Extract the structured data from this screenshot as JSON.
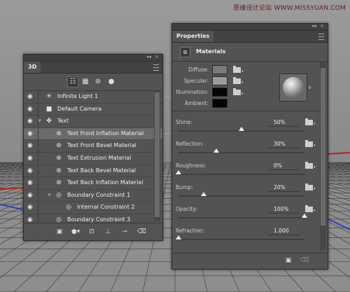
{
  "watermark": "思缘设计论坛 WWW.MISSYUAN.COM",
  "panel3d": {
    "tab_label": "3D",
    "filter_icons": [
      "scene-filter-icon",
      "mesh-filter-icon",
      "material-filter-icon",
      "light-filter-icon"
    ],
    "layers": [
      {
        "label": "Infinite Light 1",
        "icon": "✳",
        "icon_name": "infinite-light-icon",
        "indent": 0,
        "twisty": "",
        "selected": false
      },
      {
        "label": "Default Camera",
        "icon": "■",
        "icon_name": "camera-icon",
        "indent": 0,
        "twisty": "",
        "selected": false
      },
      {
        "label": "Text",
        "icon": "✤",
        "icon_name": "mesh-icon",
        "indent": 0,
        "twisty": "∨",
        "selected": false
      },
      {
        "label": "Text Front Inflation Material",
        "icon": "⊛",
        "icon_name": "material-icon",
        "indent": 1,
        "twisty": "",
        "selected": true
      },
      {
        "label": "Text Front Bevel Material",
        "icon": "⊛",
        "icon_name": "material-icon",
        "indent": 1,
        "twisty": "",
        "selected": false
      },
      {
        "label": "Text Extrusion Material",
        "icon": "⊛",
        "icon_name": "material-icon",
        "indent": 1,
        "twisty": "",
        "selected": false
      },
      {
        "label": "Text Back Bevel Material",
        "icon": "⊛",
        "icon_name": "material-icon",
        "indent": 1,
        "twisty": "",
        "selected": false
      },
      {
        "label": "Text Back Inflation Material",
        "icon": "⊛",
        "icon_name": "material-icon",
        "indent": 1,
        "twisty": "",
        "selected": false
      },
      {
        "label": "Boundary Constraint 1",
        "icon": "◎",
        "icon_name": "constraint-icon",
        "indent": 1,
        "twisty": "∨",
        "selected": false
      },
      {
        "label": "Internal Constraint 2",
        "icon": "◎",
        "icon_name": "constraint-icon",
        "indent": 2,
        "twisty": "",
        "selected": false
      },
      {
        "label": "Boundary Constraint 3",
        "icon": "◎",
        "icon_name": "constraint-icon",
        "indent": 1,
        "twisty": "",
        "selected": false
      }
    ],
    "bottom_icons": [
      "render-icon",
      "add-light-icon",
      "add-material-icon",
      "ground-icon",
      "constraint-add-icon",
      "trash-icon"
    ]
  },
  "properties": {
    "tab_label": "Properties",
    "section_title": "Materials",
    "material_rows": [
      {
        "label": "Diffuse:",
        "color": "#7a7a7a",
        "folder": true
      },
      {
        "label": "Specular:",
        "color": "#9a9a9a",
        "folder": true
      },
      {
        "label": "Illumination:",
        "color": "#050505",
        "folder": true
      },
      {
        "label": "Ambient:",
        "color": "#050505",
        "folder": false
      }
    ],
    "sliders": [
      {
        "label": "Shine:",
        "value": "50%",
        "fraction": 0.5,
        "folder": true
      },
      {
        "label": "Reflection:",
        "value": "30%",
        "fraction": 0.3,
        "folder": true
      },
      {
        "label": "Roughness:",
        "value": "0%",
        "fraction": 0.0,
        "folder": true
      },
      {
        "label": "Bump:",
        "value": "20%",
        "fraction": 0.2,
        "folder": true
      },
      {
        "label": "Opacity:",
        "value": "100%",
        "fraction": 1.0,
        "folder": true
      },
      {
        "label": "Refraction:",
        "value": "1.000",
        "fraction": 0.0,
        "folder": false
      }
    ]
  }
}
